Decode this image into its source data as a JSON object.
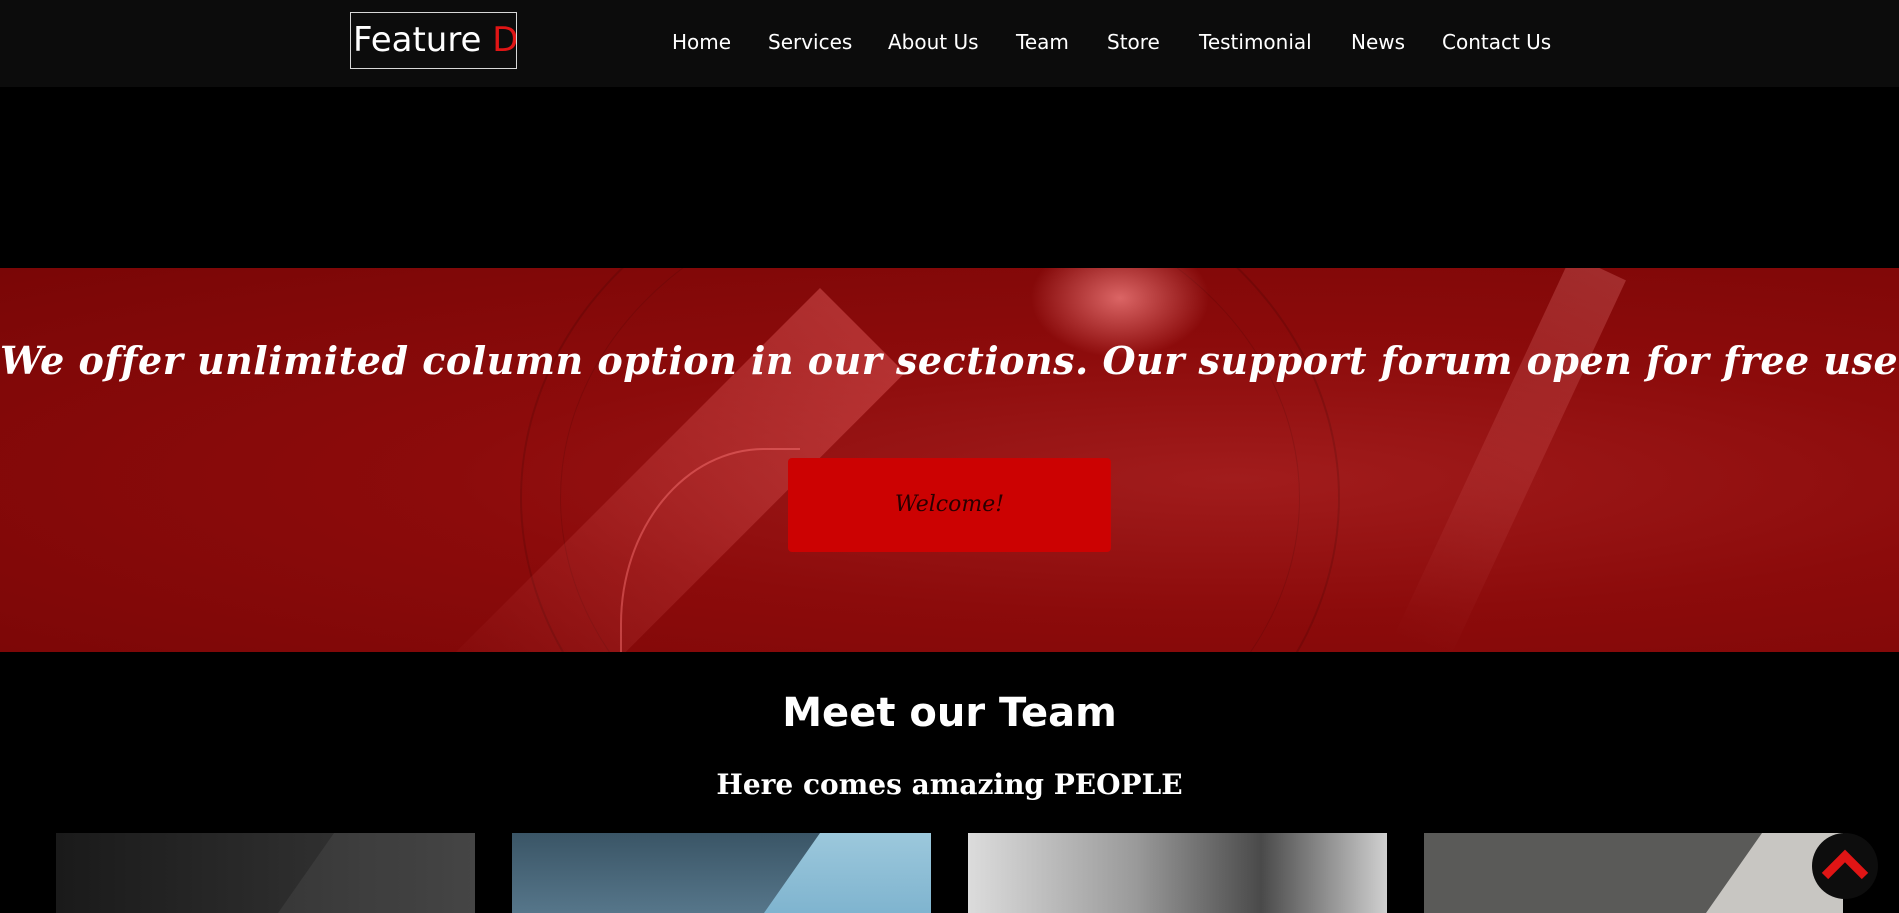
{
  "brand": {
    "name": "Feature",
    "accent_letter": "D",
    "accent_color": "#e01515"
  },
  "nav": {
    "items": [
      {
        "label": "Home"
      },
      {
        "label": "Services"
      },
      {
        "label": "About Us"
      },
      {
        "label": "Team"
      },
      {
        "label": "Store"
      },
      {
        "label": "Testimonial"
      },
      {
        "label": "News"
      },
      {
        "label": "Contact Us"
      }
    ]
  },
  "banner": {
    "text": "We offer unlimited column option in our sections. Our support forum open for free users also.",
    "button_label": "Welcome!",
    "background_color": "#8c0b0b",
    "button_color": "#cc0202"
  },
  "team": {
    "title": "Meet our Team",
    "subtitle": "Here comes amazing PEOPLE"
  },
  "scroll_top": {
    "icon": "chevron-up-icon",
    "color": "#e01515"
  }
}
